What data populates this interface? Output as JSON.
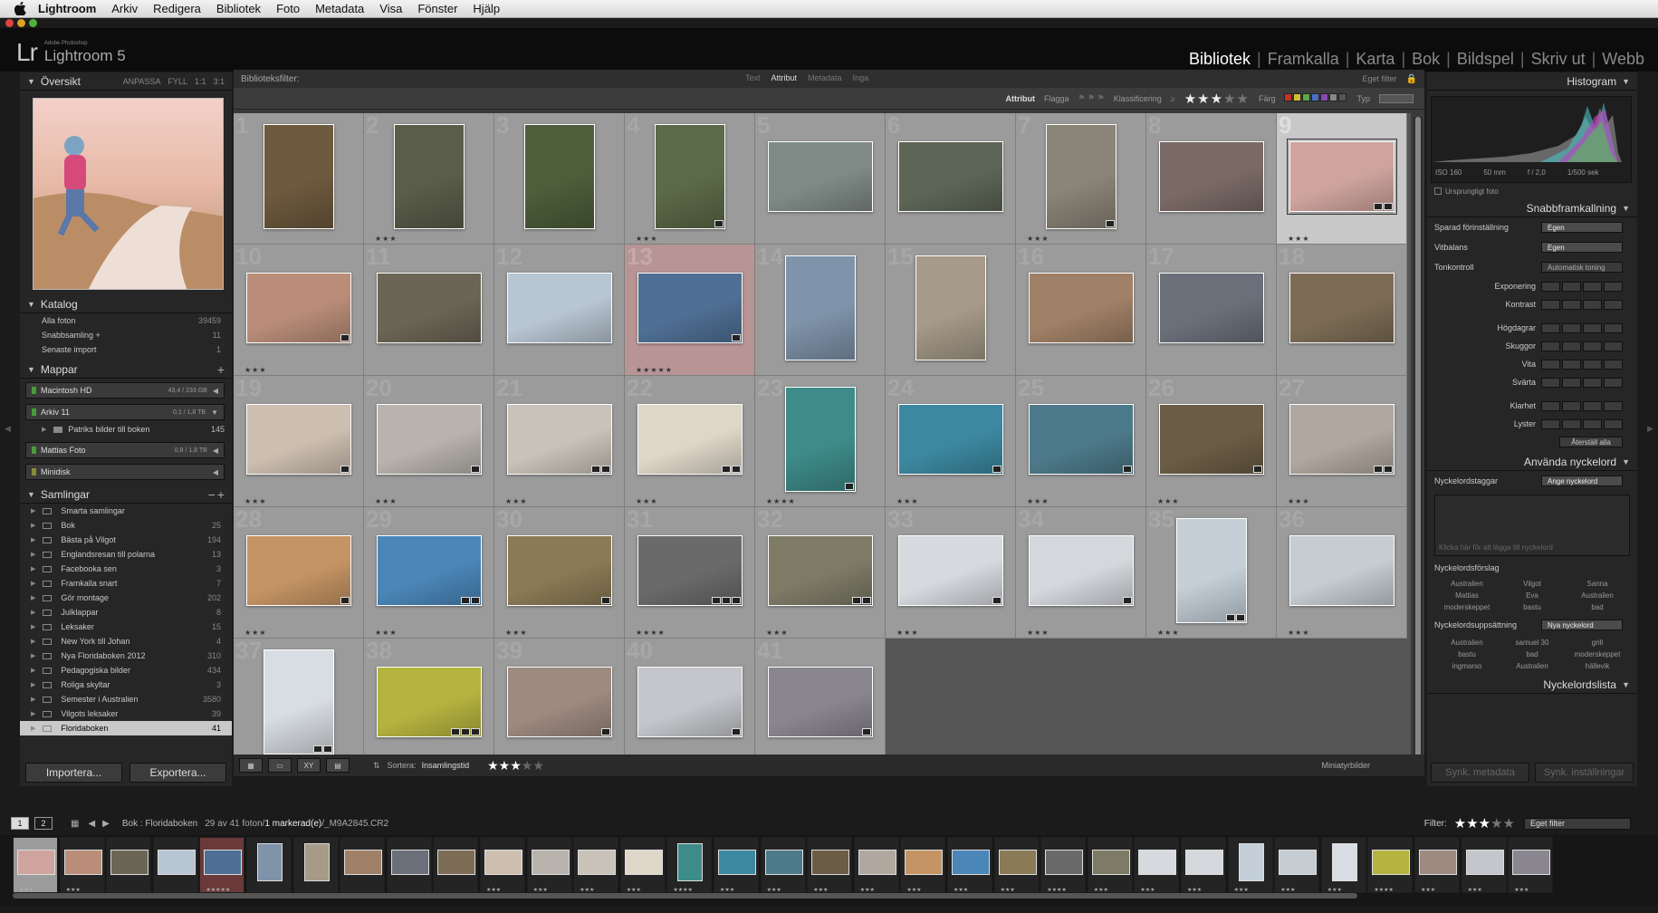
{
  "menubar": {
    "app": "Lightroom",
    "items": [
      "Arkiv",
      "Redigera",
      "Bibliotek",
      "Foto",
      "Metadata",
      "Visa",
      "Fönster",
      "Hjälp"
    ]
  },
  "identity": {
    "logo_mark": "Lr",
    "logo_small": "Adobe Photoshop",
    "logo_name": "Lightroom 5",
    "modules": [
      {
        "label": "Bibliotek",
        "active": true
      },
      {
        "label": "Framkalla",
        "active": false
      },
      {
        "label": "Karta",
        "active": false
      },
      {
        "label": "Bok",
        "active": false
      },
      {
        "label": "Bildspel",
        "active": false
      },
      {
        "label": "Skriv ut",
        "active": false
      },
      {
        "label": "Webb",
        "active": false
      }
    ]
  },
  "left": {
    "navigator": {
      "title": "Översikt",
      "opts": [
        "ANPASSA",
        "FYLL",
        "1:1",
        "3:1"
      ]
    },
    "catalog": {
      "title": "Katalog",
      "rows": [
        {
          "label": "Alla foton",
          "count": "39459"
        },
        {
          "label": "Snabbsamling +",
          "count": "11"
        },
        {
          "label": "Senaste import",
          "count": "1"
        }
      ]
    },
    "folders": {
      "title": "Mappar",
      "volumes": [
        {
          "label": "Macintosh HD",
          "size": "43,4 / 233 GB"
        },
        {
          "label": "Arkiv 11",
          "size": "0,1 / 1,8 TB"
        }
      ],
      "sub": {
        "label": "Patriks bilder till boken",
        "count": "145"
      },
      "volumes2": [
        {
          "label": "Mattias Foto",
          "size": "0,8 / 1,8 TB"
        },
        {
          "label": "Minidisk",
          "size": ""
        }
      ]
    },
    "collections": {
      "title": "Samlingar",
      "items": [
        {
          "label": "Smarta samlingar",
          "count": ""
        },
        {
          "label": "Bok",
          "count": "25"
        },
        {
          "label": "Bästa på Vilgot",
          "count": "194"
        },
        {
          "label": "Englandsresan till polarna",
          "count": "13"
        },
        {
          "label": "Facebooka sen",
          "count": "3"
        },
        {
          "label": "Framkalla snart",
          "count": "7"
        },
        {
          "label": "Gör montage",
          "count": "202"
        },
        {
          "label": "Julklappar",
          "count": "8"
        },
        {
          "label": "Leksaker",
          "count": "15"
        },
        {
          "label": "New York till Johan",
          "count": "4"
        },
        {
          "label": "Nya Floridaboken 2012",
          "count": "310"
        },
        {
          "label": "Pedagogiska bilder",
          "count": "434"
        },
        {
          "label": "Roliga skyltar",
          "count": "3"
        },
        {
          "label": "Semester i Australien",
          "count": "3580"
        },
        {
          "label": "Vilgots leksaker",
          "count": "39"
        },
        {
          "label": "Floridaboken",
          "count": "41"
        }
      ]
    },
    "import_label": "Importera...",
    "export_label": "Exportera..."
  },
  "center": {
    "filter_label": "Biblioteksfilter:",
    "filter_tabs": [
      "Text",
      "Attribut",
      "Metadata",
      "Inga"
    ],
    "filter_active": "Attribut",
    "custom_filter": "Eget filter",
    "attr": {
      "label": "Attribut",
      "flag": "Flagga",
      "rating": "Klassificering",
      "color": "Färg",
      "type": "Typ"
    },
    "rating_filter_stars": 3,
    "color_swatches": [
      "#c8302c",
      "#d6c02a",
      "#5aa84a",
      "#4a6fc8",
      "#8a4ab0",
      "#888888",
      "#555555"
    ],
    "toolbar": {
      "sort_label": "Sortera:",
      "sort_value": "Insamlingstid",
      "stars": 3,
      "thumbs_label": "Miniatyrbilder"
    }
  },
  "grid": {
    "columns": 9,
    "cells": [
      {
        "num": "1",
        "stars": "",
        "color": "#6e5a3e",
        "shape": "p",
        "badges": 0
      },
      {
        "num": "2",
        "stars": "★★★",
        "color": "#5a5d4a",
        "shape": "p",
        "badges": 0
      },
      {
        "num": "3",
        "stars": "",
        "color": "#4c5e3a",
        "shape": "p",
        "badges": 0
      },
      {
        "num": "4",
        "stars": "★★★",
        "color": "#5b6a48",
        "shape": "p",
        "badges": 1
      },
      {
        "num": "5",
        "stars": "",
        "color": "#7f8a86",
        "shape": "l",
        "badges": 0
      },
      {
        "num": "6",
        "stars": "",
        "color": "#5d6656",
        "shape": "l",
        "badges": 0
      },
      {
        "num": "7",
        "stars": "★★★",
        "color": "#8b8478",
        "shape": "p",
        "badges": 1
      },
      {
        "num": "8",
        "stars": "",
        "color": "#7a6a66",
        "shape": "l",
        "badges": 0
      },
      {
        "num": "9",
        "stars": "★★★",
        "color": "#cfa49e",
        "shape": "l",
        "badges": 2,
        "state": "hl"
      },
      {
        "num": "10",
        "stars": "★★★",
        "color": "#b98d78",
        "shape": "l",
        "badges": 1
      },
      {
        "num": "11",
        "stars": "",
        "color": "#6b6555",
        "shape": "l",
        "badges": 0
      },
      {
        "num": "12",
        "stars": "",
        "color": "#b8c5d2",
        "shape": "l",
        "badges": 0
      },
      {
        "num": "13",
        "stars": "★★★★★",
        "color": "#4f6f94",
        "shape": "l",
        "badges": 1,
        "state": "pk"
      },
      {
        "num": "14",
        "stars": "",
        "color": "#7f93aa",
        "shape": "p",
        "badges": 0
      },
      {
        "num": "15",
        "stars": "",
        "color": "#a69a88",
        "shape": "p",
        "badges": 0
      },
      {
        "num": "16",
        "stars": "",
        "color": "#a08066",
        "shape": "l",
        "badges": 0
      },
      {
        "num": "17",
        "stars": "",
        "color": "#6a6f7a",
        "shape": "l",
        "badges": 0
      },
      {
        "num": "18",
        "stars": "",
        "color": "#7c6c55",
        "shape": "l",
        "badges": 0
      },
      {
        "num": "19",
        "stars": "★★★",
        "color": "#cdbfb0",
        "shape": "l",
        "badges": 1
      },
      {
        "num": "20",
        "stars": "★★★",
        "color": "#b8b3ac",
        "shape": "l",
        "badges": 1
      },
      {
        "num": "21",
        "stars": "★★★",
        "color": "#c9c2b8",
        "shape": "l",
        "badges": 2
      },
      {
        "num": "22",
        "stars": "★★★",
        "color": "#ded6c8",
        "shape": "l",
        "badges": 2
      },
      {
        "num": "23",
        "stars": "★★★★",
        "color": "#3e8c8a",
        "shape": "p",
        "badges": 1
      },
      {
        "num": "24",
        "stars": "★★★",
        "color": "#3c88a0",
        "shape": "l",
        "badges": 1
      },
      {
        "num": "25",
        "stars": "★★★",
        "color": "#4d7a8a",
        "shape": "l",
        "badges": 1
      },
      {
        "num": "26",
        "stars": "★★★",
        "color": "#6b5d45",
        "shape": "l",
        "badges": 1
      },
      {
        "num": "27",
        "stars": "★★★",
        "color": "#b0a79e",
        "shape": "l",
        "badges": 2
      },
      {
        "num": "28",
        "stars": "★★★",
        "color": "#c59464",
        "shape": "l",
        "badges": 1
      },
      {
        "num": "29",
        "stars": "★★★",
        "color": "#4a86b8",
        "shape": "l",
        "badges": 2
      },
      {
        "num": "30",
        "stars": "★★★",
        "color": "#8a7a55",
        "shape": "l",
        "badges": 1
      },
      {
        "num": "31",
        "stars": "★★★★",
        "color": "#6a6a6a",
        "shape": "l",
        "badges": 3
      },
      {
        "num": "32",
        "stars": "★★★",
        "color": "#7d7a66",
        "shape": "l",
        "badges": 2
      },
      {
        "num": "33",
        "stars": "★★★",
        "color": "#d6d9de",
        "shape": "l",
        "badges": 1
      },
      {
        "num": "34",
        "stars": "★★★",
        "color": "#d4d7dc",
        "shape": "l",
        "badges": 1
      },
      {
        "num": "35",
        "stars": "★★★",
        "color": "#c4cfd8",
        "shape": "p",
        "badges": 2
      },
      {
        "num": "36",
        "stars": "★★★",
        "color": "#c5ccd2",
        "shape": "l",
        "badges": 0
      },
      {
        "num": "37",
        "stars": "★★★",
        "color": "#d8dde3",
        "shape": "p",
        "badges": 2
      },
      {
        "num": "38",
        "stars": "★★★★",
        "color": "#b6b440",
        "shape": "l",
        "badges": 3
      },
      {
        "num": "39",
        "stars": "★★★",
        "color": "#9d8a80",
        "shape": "l",
        "badges": 1
      },
      {
        "num": "40",
        "stars": "★★★",
        "color": "#c4c6cb",
        "shape": "l",
        "badges": 1
      },
      {
        "num": "41",
        "stars": "★★★",
        "color": "#8a8690",
        "shape": "l",
        "badges": 1
      }
    ]
  },
  "right": {
    "histogram": {
      "title": "Histogram",
      "iso": "ISO 160",
      "focal": "50 mm",
      "aperture": "f / 2,0",
      "shutter": "1/500 sek"
    },
    "original_photo": "Ursprungligt foto",
    "quick_develop": {
      "title": "Snabbframkallning",
      "preset_label": "Sparad förinställning",
      "preset_value": "Egen",
      "wb_label": "Vitbalans",
      "wb_value": "Egen",
      "tone_label": "Tonkontroll",
      "tone_value": "Automatisk toning",
      "sliders": [
        "Exponering",
        "Kontrast",
        "Högdagrar",
        "Skuggor",
        "Vita",
        "Svärta",
        "Klarhet",
        "Lyster"
      ],
      "reset": "Återställ alla"
    },
    "keywording": {
      "title": "Använda nyckelord",
      "tags_label": "Nyckelordstaggar",
      "tags_value": "Ange nyckelord",
      "placeholder": "Klicka här för att lägga till nyckelord",
      "suggest_title": "Nyckelordsförslag",
      "suggestions": [
        "Australien",
        "Vilgot",
        "Sanna",
        "Mattias",
        "Eva",
        "Australien",
        "moderskeppet",
        "bastu",
        "bad"
      ],
      "set_label": "Nyckelordsuppsättning",
      "set_value": "Nya nyckelord",
      "set_items": [
        "Australien",
        "samuel 30",
        "grill",
        "bastu",
        "bad",
        "moderskeppet",
        "ingmarso",
        "Australien",
        "hällevik"
      ]
    },
    "keyword_list": "Nyckelordslista",
    "sync_meta": "Synk. metadata",
    "sync_settings": "Synk. inställningar"
  },
  "filmstrip": {
    "pages": [
      "1",
      "2"
    ],
    "source_prefix": "Bok : Floridaboken",
    "source_info": "29 av 41 foton/",
    "selected": "1 markerad(e)",
    "filename": "/_M9A2845.CR2",
    "filter_label": "Filter:",
    "filter_stars": 3,
    "filter_value": "Eget filter"
  }
}
